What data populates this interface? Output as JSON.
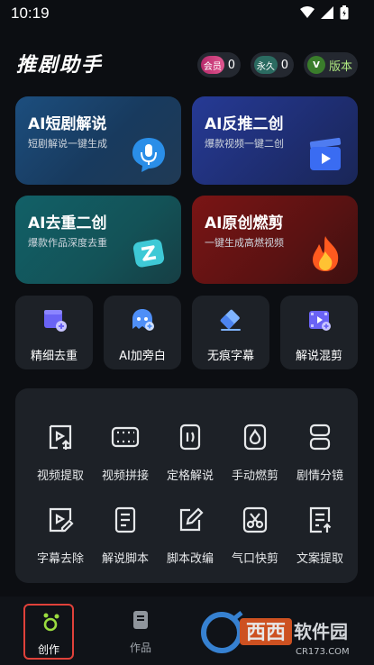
{
  "status": {
    "time": "10:19"
  },
  "header": {
    "title": "推剧助手",
    "member_label": "会员",
    "member_count": "0",
    "perm_label": "永久",
    "perm_count": "0",
    "version_badge": "V",
    "version_label": "版本"
  },
  "cards": [
    {
      "title": "AI短剧解说",
      "subtitle": "短剧解说一键生成",
      "icon": "microphone-icon"
    },
    {
      "title": "AI反推二创",
      "subtitle": "爆款视频一键二创",
      "icon": "clapperboard-icon"
    },
    {
      "title": "AI去重二创",
      "subtitle": "爆款作品深度去重",
      "icon": "z-badge-icon"
    },
    {
      "title": "AI原创燃剪",
      "subtitle": "一键生成高燃视频",
      "icon": "flame-icon"
    }
  ],
  "tools": [
    {
      "label": "精细去重",
      "icon": "video-plus-icon"
    },
    {
      "label": "AI加旁白",
      "icon": "chat-ghost-icon"
    },
    {
      "label": "无痕字幕",
      "icon": "eraser-icon"
    },
    {
      "label": "解说混剪",
      "icon": "film-mix-icon"
    }
  ],
  "grid": [
    {
      "label": "视频提取",
      "icon": "video-extract-icon"
    },
    {
      "label": "视频拼接",
      "icon": "film-strip-icon"
    },
    {
      "label": "定格解说",
      "icon": "freeze-frame-icon"
    },
    {
      "label": "手动燃剪",
      "icon": "flame-outline-icon"
    },
    {
      "label": "剧情分镜",
      "icon": "storyboard-icon"
    },
    {
      "label": "字幕去除",
      "icon": "subtitle-remove-icon"
    },
    {
      "label": "解说脚本",
      "icon": "script-doc-icon"
    },
    {
      "label": "脚本改编",
      "icon": "edit-icon"
    },
    {
      "label": "气口快剪",
      "icon": "scissors-icon"
    },
    {
      "label": "文案提取",
      "icon": "doc-extract-icon"
    }
  ],
  "tabbar": {
    "tabs": [
      {
        "label": "创作",
        "icon": "create-icon",
        "active": true
      },
      {
        "label": "作品",
        "icon": "works-icon",
        "active": false
      }
    ]
  },
  "watermark": {
    "text1": "西西",
    "text2": "软件园",
    "text3": "CR173.COM"
  },
  "colors": {
    "background": "#0c0e12",
    "accent_green": "#9bdc3f",
    "active_tab_border": "#e0413a"
  }
}
